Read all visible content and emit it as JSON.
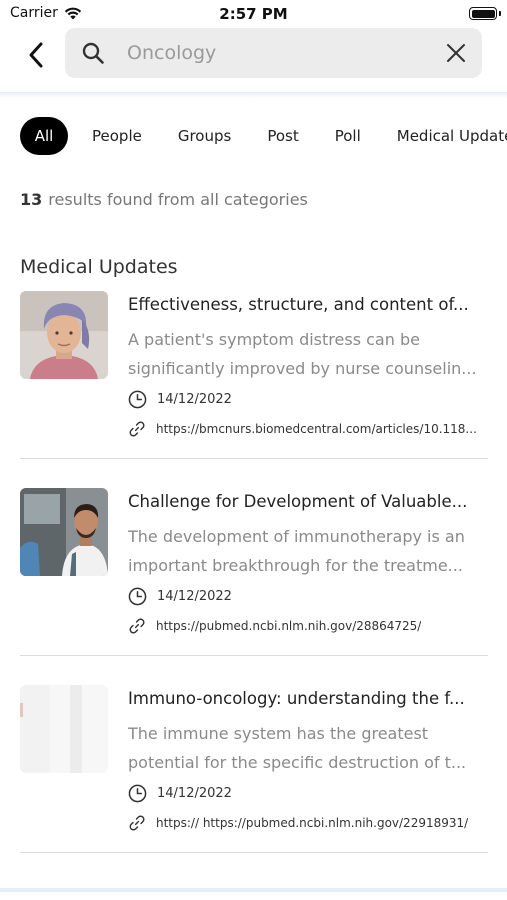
{
  "status_bar": {
    "carrier": "Carrier",
    "time": "2:57 PM"
  },
  "search": {
    "placeholder": "Oncology",
    "value": ""
  },
  "tabs": [
    {
      "label": "All",
      "active": true
    },
    {
      "label": "People",
      "active": false
    },
    {
      "label": "Groups",
      "active": false
    },
    {
      "label": "Post",
      "active": false
    },
    {
      "label": "Poll",
      "active": false
    },
    {
      "label": "Medical Updates",
      "active": false
    }
  ],
  "results": {
    "count": "13",
    "text": "results found from all categories"
  },
  "section_title": "Medical Updates",
  "articles": [
    {
      "title": "Effectiveness, structure, and content of...",
      "desc_line1": "A patient's symptom distress can be",
      "desc_line2": "significantly improved by nurse counselin...",
      "date": "14/12/2022",
      "link": "https://bmcnurs.biomedcentral.com/articles/10.118..."
    },
    {
      "title": "Challenge for Development of Valuable...",
      "desc_line1": "The development of immunotherapy is an",
      "desc_line2": "important breakthrough for the treatme...",
      "date": "14/12/2022",
      "link": "https://pubmed.ncbi.nlm.nih.gov/28864725/"
    },
    {
      "title": "Immuno-oncology: understanding the f...",
      "desc_line1": "The immune system has the greatest",
      "desc_line2": "potential for the specific destruction of t...",
      "date": "14/12/2022",
      "link": "https:// https://pubmed.ncbi.nlm.nih.gov/22918931/"
    }
  ],
  "icons": {
    "back": "chevron-left-icon",
    "search": "search-icon",
    "clear": "close-icon",
    "date": "clock-icon",
    "link": "link-icon"
  }
}
